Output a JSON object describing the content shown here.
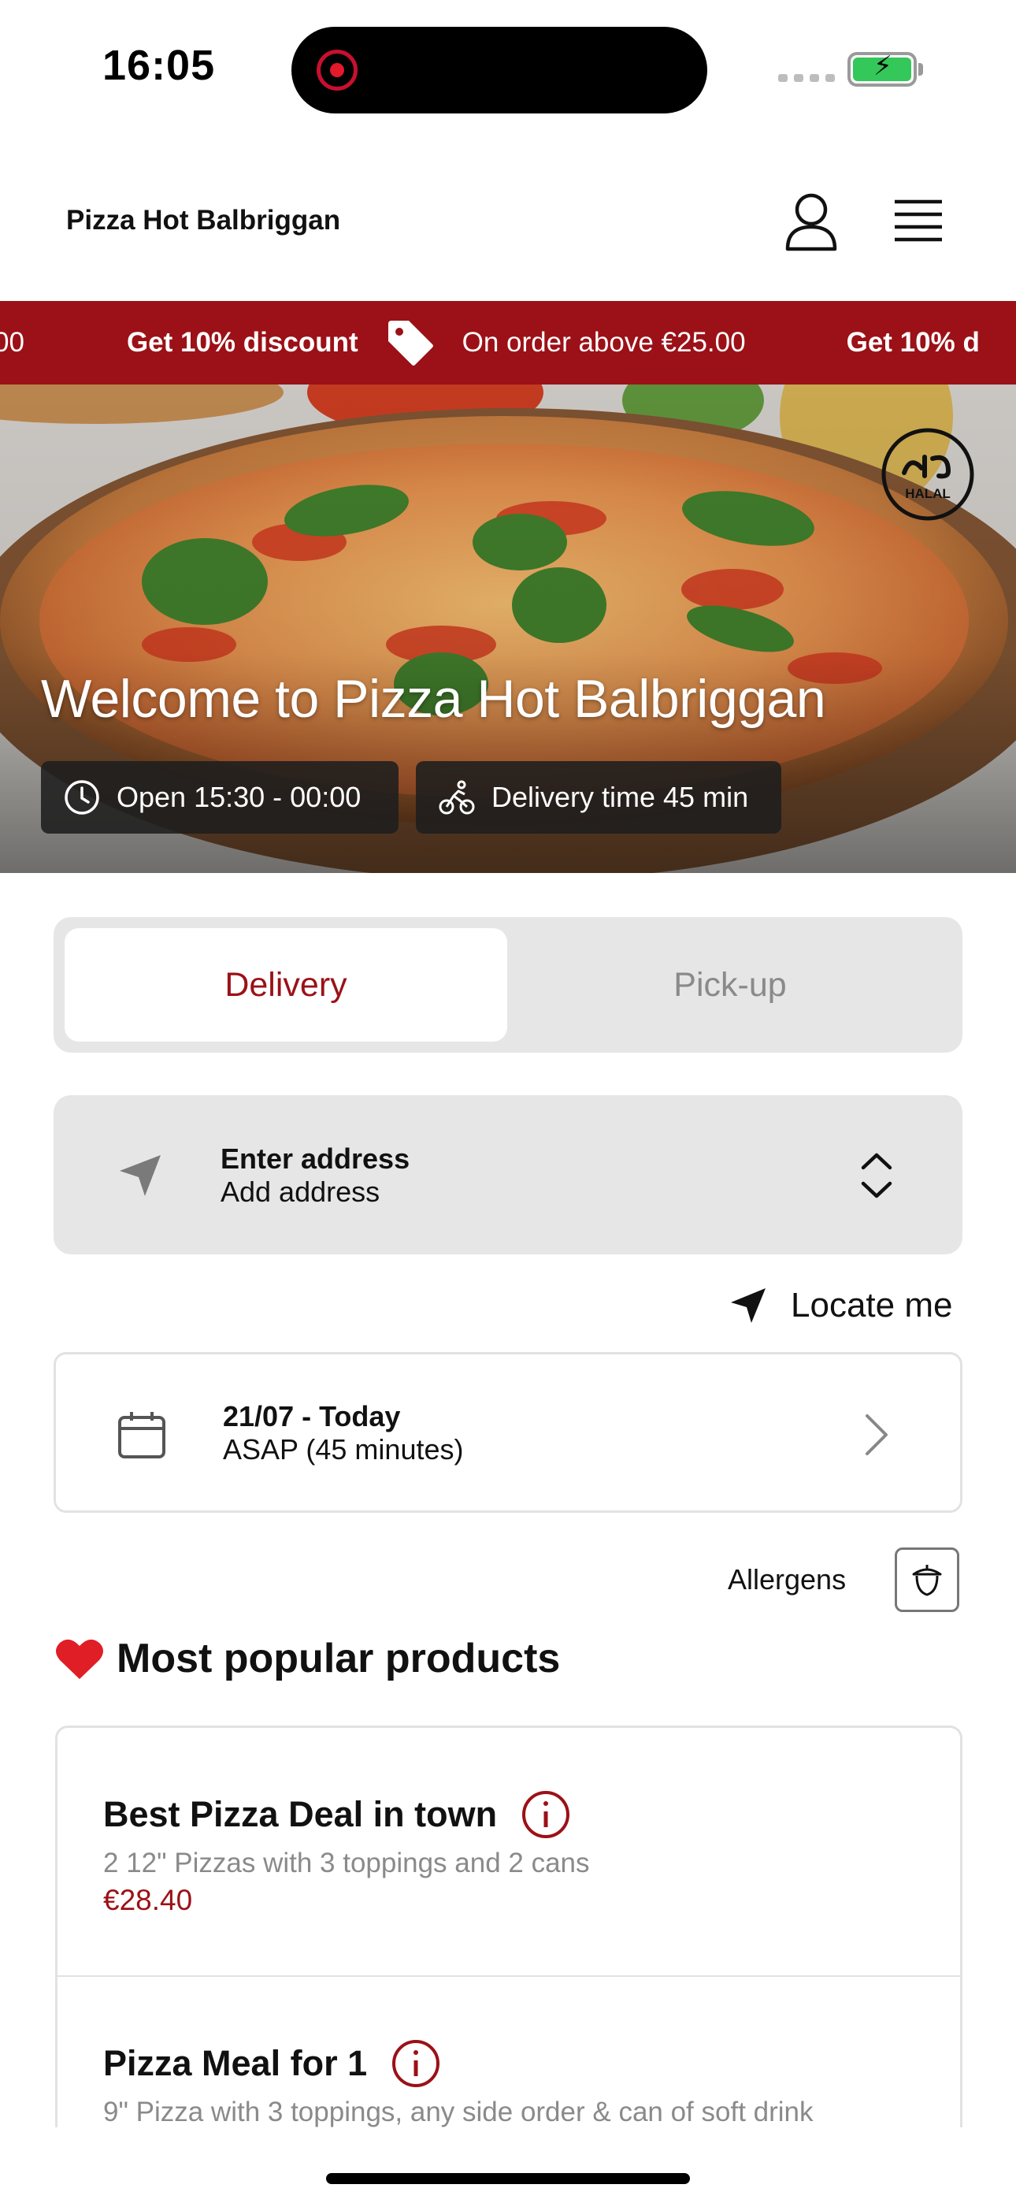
{
  "status_bar": {
    "time": "16:05"
  },
  "header": {
    "title": "Pizza Hot Balbriggan"
  },
  "promo": {
    "lead_fragment": "00",
    "items": [
      {
        "bold": "Get 10% discount",
        "text": "On order above €25.00"
      }
    ],
    "trailing_fragment": "Get 10% d"
  },
  "hero": {
    "badge": "HALAL",
    "title": "Welcome to Pizza Hot Balbriggan",
    "open_hours": "Open 15:30 - 00:00",
    "delivery_time": "Delivery time 45 min"
  },
  "order_type": {
    "options": [
      "Delivery",
      "Pick-up"
    ],
    "selected": "Delivery"
  },
  "address": {
    "title": "Enter address",
    "subtitle": "Add address"
  },
  "locate": {
    "label": "Locate me"
  },
  "schedule": {
    "date": "21/07 - Today",
    "time": "ASAP (45 minutes)"
  },
  "allergens": {
    "label": "Allergens"
  },
  "popular": {
    "title": "Most popular products",
    "products": [
      {
        "name": "Best Pizza Deal in town",
        "description": "2 12\" Pizzas with 3 toppings and 2 cans",
        "price": "€28.40"
      },
      {
        "name": "Pizza Meal for 1",
        "description": "9\" Pizza with 3 toppings, any side order & can of soft drink",
        "price": ""
      }
    ]
  },
  "colors": {
    "brand": "#9b1117",
    "panel": "#e6e6e6"
  }
}
